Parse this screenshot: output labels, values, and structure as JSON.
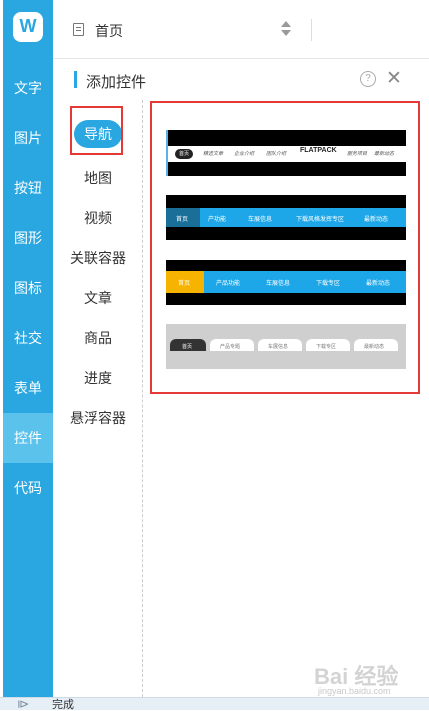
{
  "sidebar": {
    "logo": "W",
    "items": [
      {
        "label": "文字"
      },
      {
        "label": "图片"
      },
      {
        "label": "按钮"
      },
      {
        "label": "图形"
      },
      {
        "label": "图标"
      },
      {
        "label": "社交"
      },
      {
        "label": "表单"
      },
      {
        "label": "控件",
        "active": true
      },
      {
        "label": "代码"
      }
    ]
  },
  "topbar": {
    "page_name": "首页"
  },
  "panel": {
    "title": "添加控件",
    "help": "?",
    "close": "✕"
  },
  "categories": [
    {
      "label": "导航",
      "active": true
    },
    {
      "label": "地图"
    },
    {
      "label": "视频"
    },
    {
      "label": "关联容器"
    },
    {
      "label": "文章"
    },
    {
      "label": "商品"
    },
    {
      "label": "进度"
    },
    {
      "label": "悬浮容器"
    }
  ],
  "widgets": [
    {
      "style": "black-white",
      "home": "首页",
      "items": [
        "精选文章",
        "企业介绍",
        "团队介绍",
        "服务项目",
        "最新动态"
      ],
      "brand": "FLATPACK"
    },
    {
      "style": "blue-dark-home",
      "home": "首页",
      "items": [
        "产功能",
        "车展信息",
        "下载风格发挥专区",
        "最新动态"
      ]
    },
    {
      "style": "blue-yellow-home",
      "home": "首页",
      "items": [
        "产品功能",
        "车展信息",
        "下载专区",
        "最新动态"
      ]
    },
    {
      "style": "gray-tabs",
      "home": "首页",
      "items": [
        "产品专题",
        "车展信息",
        "下载专区",
        "最新动态"
      ]
    }
  ],
  "status": {
    "text": "完成"
  },
  "watermark": {
    "text": "Bai 经验",
    "sub": "jingyan.baidu.com"
  },
  "colors": {
    "accent": "#2aa7e0",
    "highlight": "#e53935"
  }
}
